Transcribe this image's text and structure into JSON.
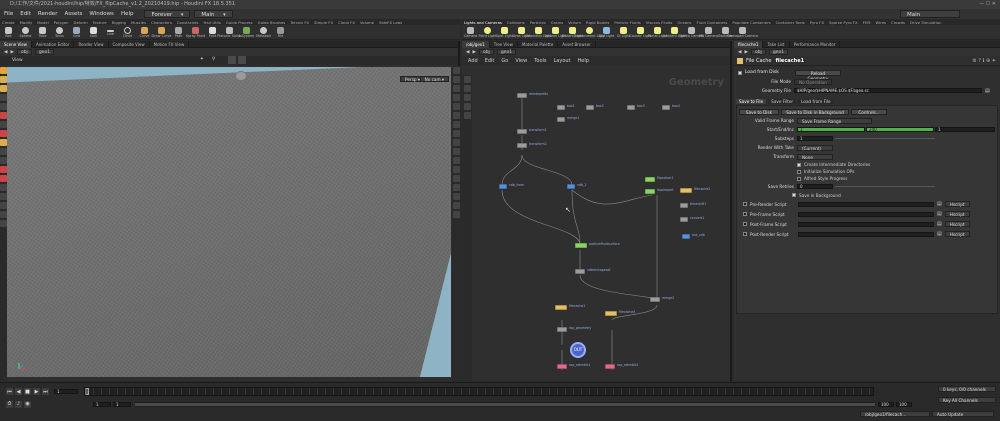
{
  "window": {
    "title": "D:/工作/文件/2021-houdini/hip/特效/FX_flipCache_v1.2_20210419.hip - Houdini FX 18.5.351"
  },
  "menu": {
    "items": [
      "File",
      "Edit",
      "Render",
      "Assets",
      "Windows",
      "Help"
    ],
    "desktop": "Forever",
    "context": "Main",
    "right_context": "Main"
  },
  "shelf_left": {
    "tabs": [
      "Create",
      "Modify",
      "Model",
      "Polygon",
      "Deform",
      "Texture",
      "Rigging",
      "Muscles",
      "Characters",
      "Constraints",
      "Hair Utils",
      "Guide Process",
      "Guide Brushes",
      "Terrain FX",
      "Simple FX",
      "Cloud FX",
      "Volume",
      "SideFX Labs"
    ],
    "tools": [
      "Box",
      "Sphere",
      "Tube",
      "Torus",
      "Grid",
      "Null",
      "Line",
      "Circle",
      "Curve",
      "Draw Curve",
      "Path",
      "Spray Paint",
      "Font",
      "Platonic Solids",
      "L-System",
      "Metaball",
      "File"
    ]
  },
  "shelf_right": {
    "tabs": [
      "Lights and Cameras",
      "Collisions",
      "Particles",
      "Grains",
      "Vellum",
      "Rigid Bodies",
      "Particle Fluids",
      "Viscous Fluids",
      "Oceans",
      "Fluid Containers",
      "Populate Containers",
      "Container Tools",
      "Pyro FX",
      "Sparse Pyro FX",
      "FEM",
      "Wires",
      "Crowds",
      "Drive Simulation"
    ],
    "tools": [
      "Camera",
      "Point Light",
      "Spot Light",
      "Area Light",
      "Geometry Light",
      "Volume Light",
      "Distant Light",
      "Environment Light",
      "Sky Light",
      "GI Light",
      "Caustic Light",
      "Portal Light",
      "Ambient Light",
      "Stereo Camera",
      "VR Camera",
      "Switcher",
      "Gamepad Camera"
    ]
  },
  "left_pane": {
    "tabs": [
      "Scene View",
      "Animation Editor",
      "Render View",
      "Composite View",
      "Motion FX View"
    ],
    "path": [
      "obj",
      "geo1"
    ],
    "view_label": "View",
    "persp_label": "Persp",
    "cam_label": "No cam"
  },
  "network_pane": {
    "tabs": [
      "/obj/geo1",
      "Tree View",
      "Material Palette",
      "Asset Browser"
    ],
    "path": [
      "obj",
      "geo1"
    ],
    "menu": [
      "Add",
      "Edit",
      "Go",
      "View",
      "Tools",
      "Layout",
      "Help"
    ],
    "watermark": "Geometry",
    "nodes": [
      {
        "name": "deleteprefix",
        "color": "#a8a8a8"
      },
      {
        "name": "box1",
        "color": "#a8a8a8"
      },
      {
        "name": "box2",
        "color": "#a8a8a8"
      },
      {
        "name": "box3",
        "color": "#a8a8a8"
      },
      {
        "name": "box4",
        "color": "#a8a8a8"
      },
      {
        "name": "merge1",
        "color": "#a8a8a8"
      },
      {
        "name": "transform1",
        "color": "#a8a8a8"
      },
      {
        "name": "transform2",
        "color": "#a8a8a8"
      },
      {
        "name": "vdb_from",
        "color": "#5b8fd6"
      },
      {
        "name": "vdb_2",
        "color": "#5b8fd6"
      },
      {
        "name": "flipsolver1",
        "color": "#8fd06a"
      },
      {
        "name": "dopimport",
        "color": "#8fd06a"
      },
      {
        "name": "filecache2",
        "color": "#e0c070"
      },
      {
        "name": "timeshift1",
        "color": "#a8a8a8"
      },
      {
        "name": "convert1",
        "color": "#a8a8a8"
      },
      {
        "name": "out_vdb",
        "color": "#5b8fd6"
      },
      {
        "name": "particlefluidsurface",
        "color": "#8fd06a"
      },
      {
        "name": "vdbreshapesdf",
        "color": "#a8a8a8"
      },
      {
        "name": "merge2",
        "color": "#a8a8a8"
      },
      {
        "name": "filecache1",
        "color": "#e0c070"
      },
      {
        "name": "filecache3",
        "color": "#e0c070"
      },
      {
        "name": "rop_geometry",
        "color": "#a8a8a8"
      },
      {
        "name": "OUT",
        "color": "#4a66c8"
      },
      {
        "name": "rop_alembic1",
        "color": "#e06a8a"
      },
      {
        "name": "rop_alembic2",
        "color": "#e06a8a"
      }
    ]
  },
  "param_pane": {
    "tabs": [
      "filecache1",
      "Take List",
      "Performance Monitor"
    ],
    "path": [
      "obj",
      "geo1"
    ],
    "node_type": "File Cache",
    "node_name": "filecache1",
    "load_from_disk": "Load from Disk",
    "reload_geometry": "Reload Geometry",
    "file_mode_label": "File Mode",
    "file_mode_value": "No Operation",
    "geometry_file_label": "Geometry File",
    "geometry_file_value": "$HIP/geo/$HIPNAME.$OS.$F.bgeo.sc",
    "subtabs": [
      "Save to File",
      "Save Filter",
      "Load from File"
    ],
    "save_to_disk": "Save to Disk",
    "save_bg": "Save to Disk in Background",
    "controls": "Controls...",
    "valid_range_label": "Valid Frame Range",
    "valid_range_value": "Save Frame Range",
    "start_end_label": "Start/End/Inc",
    "start_value": "1",
    "end_value": "240",
    "inc_value": "1",
    "substeps_label": "Substeps",
    "substeps_value": "1",
    "render_take_label": "Render With Take",
    "render_take_value": "(Current)",
    "transform_label": "Transform",
    "transform_value": "None",
    "checks": [
      {
        "label": "Create Intermediate Directories",
        "on": true
      },
      {
        "label": "Initialize Simulation OPs",
        "on": false
      },
      {
        "label": "Alfred Style Progress",
        "on": false
      }
    ],
    "save_retries_label": "Save Retries",
    "save_retries_value": "0",
    "save_in_bg": "Save in Background",
    "scripts": [
      "Pre-Render Script",
      "Pre-Frame Script",
      "Post-Frame Script",
      "Post-Render Script"
    ],
    "script_lang": "Hscript"
  },
  "timeline": {
    "current_frame": "1",
    "start": "1",
    "end_a": "1",
    "range_end": "100",
    "range_end2": "100",
    "keys_label": "0 keys, 0/0 channels",
    "key_all": "Key All Channels",
    "path": "/obj/geo1/filecach...",
    "auto_update": "Auto Update"
  },
  "colors": {
    "accent_green": "#52b04a",
    "panel": "#2b2b2b"
  }
}
